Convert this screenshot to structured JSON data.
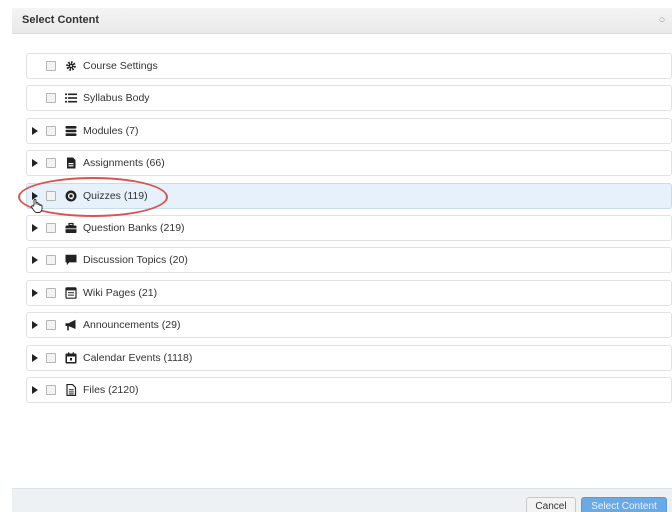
{
  "dialog": {
    "title": "Select Content",
    "close_glyph": "○"
  },
  "items": [
    {
      "label": "Course Settings",
      "icon": "gear-icon",
      "expandable": false
    },
    {
      "label": "Syllabus Body",
      "icon": "list-icon",
      "expandable": false
    },
    {
      "label": "Modules (7)",
      "icon": "stack-icon",
      "expandable": true
    },
    {
      "label": "Assignments (66)",
      "icon": "assignment-icon",
      "expandable": true
    },
    {
      "label": "Quizzes (119)",
      "icon": "quiz-icon",
      "expandable": true,
      "highlighted": true
    },
    {
      "label": "Question Banks (219)",
      "icon": "briefcase-icon",
      "expandable": true
    },
    {
      "label": "Discussion Topics (20)",
      "icon": "speech-bubble-icon",
      "expandable": true
    },
    {
      "label": "Wiki Pages (21)",
      "icon": "page-icon",
      "expandable": true
    },
    {
      "label": "Announcements (29)",
      "icon": "megaphone-icon",
      "expandable": true
    },
    {
      "label": "Calendar Events (1118)",
      "icon": "calendar-icon",
      "expandable": true
    },
    {
      "label": "Files (2120)",
      "icon": "file-icon",
      "expandable": true
    }
  ],
  "footer": {
    "cancel_label": "Cancel",
    "select_label": "Select Content"
  },
  "colors": {
    "highlight_row": "#e6f1fb",
    "annotation": "#d9534f",
    "primary_button": "#6aa9e3"
  }
}
